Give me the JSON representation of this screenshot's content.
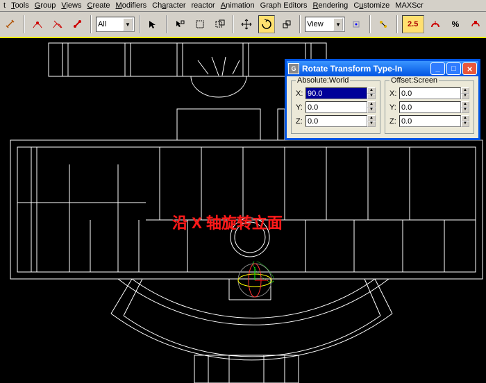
{
  "menu": {
    "items": [
      "t",
      "Tools",
      "Group",
      "Views",
      "Create",
      "Modifiers",
      "Character",
      "reactor",
      "Animation",
      "Graph Editors",
      "Rendering",
      "Customize",
      "MAXScr"
    ]
  },
  "toolbar": {
    "selection_filter": "All",
    "ref_coord": "View",
    "snap_angle": "2.5"
  },
  "viewport": {
    "annotation": "沿 X 轴旋转立面"
  },
  "dialog": {
    "title": "Rotate Transform Type-In",
    "absolute": {
      "label": "Absolute:World",
      "x": "90.0",
      "y": "0.0",
      "z": "0.0"
    },
    "offset": {
      "label": "Offset:Screen",
      "x": "0.0",
      "y": "0.0",
      "z": "0.0"
    }
  }
}
